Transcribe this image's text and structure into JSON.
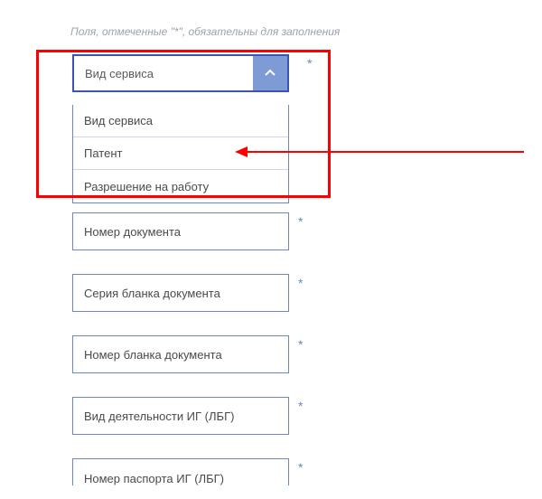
{
  "hint_text": "Поля, отмеченные \"*\", обязательны для заполнения",
  "required_mark": "*",
  "dropdown": {
    "selected": "Вид сервиса",
    "options": [
      "Вид сервиса",
      "Патент",
      "Разрешение на работу"
    ]
  },
  "fields": {
    "doc_number": "Номер документа",
    "blank_series": "Серия бланка документа",
    "blank_number": "Номер бланка документа",
    "activity_type": "Вид деятельности ИГ (ЛБГ)",
    "passport_number": "Номер паспорта ИГ (ЛБГ)"
  }
}
